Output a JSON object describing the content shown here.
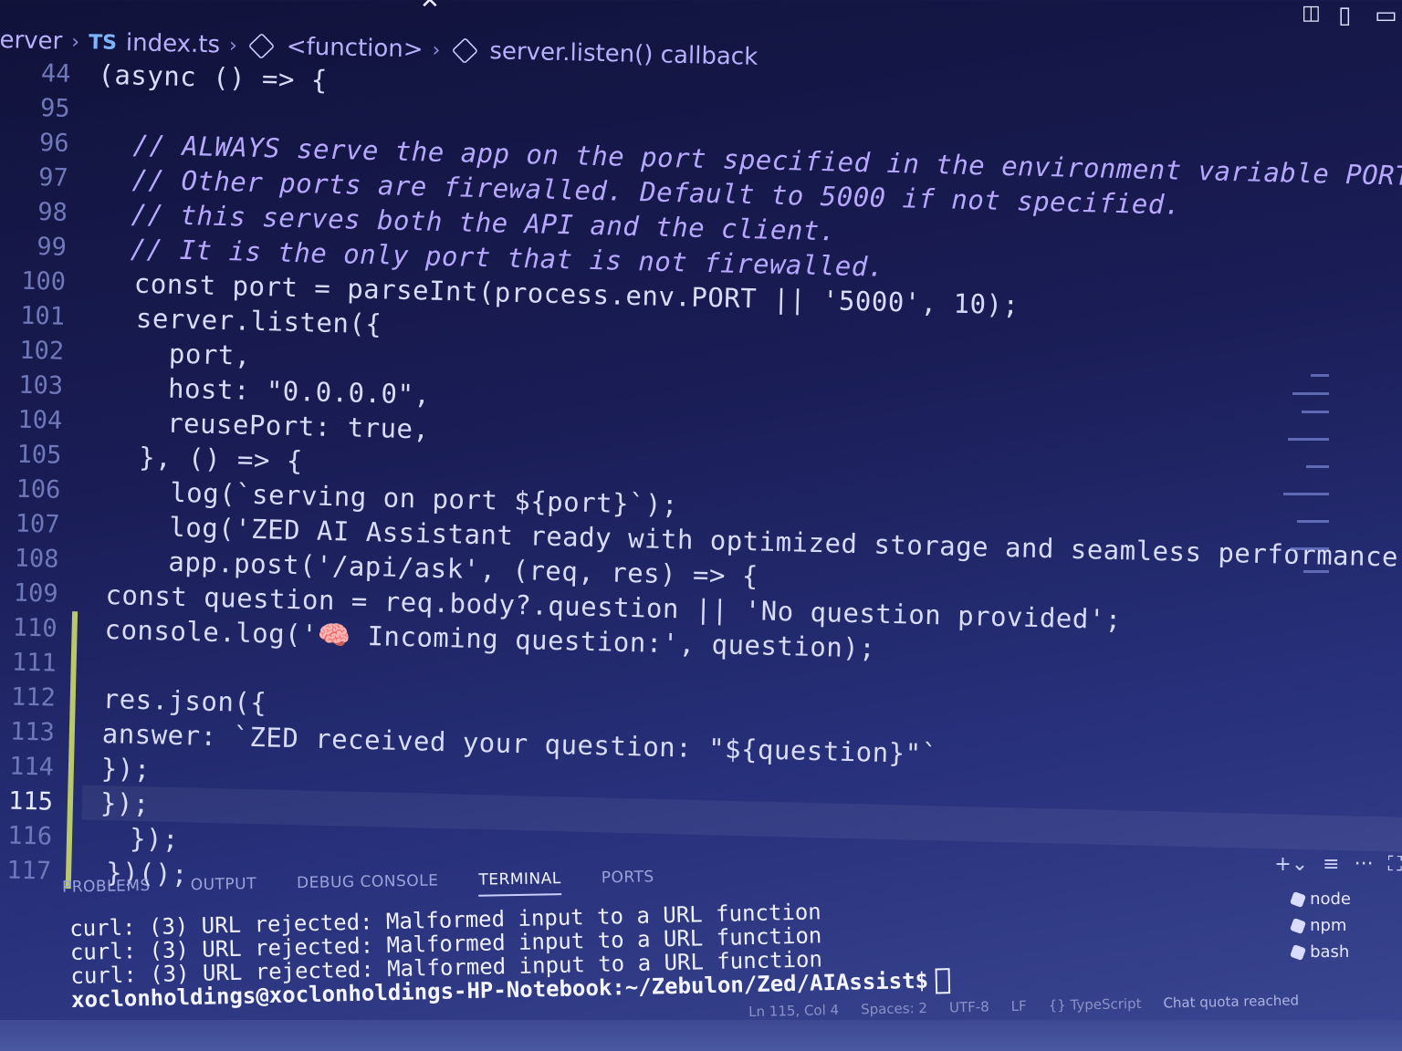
{
  "breadcrumb": {
    "seg1": "erver",
    "ts_badge": "TS",
    "file": "index.ts",
    "seg3": "<function>",
    "seg4": "server.listen() callback"
  },
  "editor": {
    "lines": [
      {
        "n": "44",
        "code": "(async () => {"
      },
      {
        "n": "95",
        "code": ""
      },
      {
        "n": "96",
        "code": "  // ALWAYS serve the app on the port specified in the environment variable PORT"
      },
      {
        "n": "97",
        "code": "  // Other ports are firewalled. Default to 5000 if not specified."
      },
      {
        "n": "98",
        "code": "  // this serves both the API and the client."
      },
      {
        "n": "99",
        "code": "  // It is the only port that is not firewalled."
      },
      {
        "n": "100",
        "code": "  const port = parseInt(process.env.PORT || '5000', 10);"
      },
      {
        "n": "101",
        "code": "  server.listen({"
      },
      {
        "n": "102",
        "code": "    port,"
      },
      {
        "n": "103",
        "code": "    host: \"0.0.0.0\","
      },
      {
        "n": "104",
        "code": "    reusePort: true,"
      },
      {
        "n": "105",
        "code": "  }, () => {"
      },
      {
        "n": "106",
        "code": "    log(`serving on port ${port}`);"
      },
      {
        "n": "107",
        "code": "    log('ZED AI Assistant ready with optimized storage and seamless performance');"
      },
      {
        "n": "108",
        "code": "    app.post('/api/ask', (req, res) => {"
      },
      {
        "n": "109",
        "code": "const question = req.body?.question || 'No question provided';"
      },
      {
        "n": "110",
        "code": "console.log('🧠 Incoming question:', question);"
      },
      {
        "n": "111",
        "code": ""
      },
      {
        "n": "112",
        "code": "res.json({"
      },
      {
        "n": "113",
        "code": "answer: `ZED received your question: \"${question}\"`"
      },
      {
        "n": "114",
        "code": "});"
      },
      {
        "n": "115",
        "code": "});"
      },
      {
        "n": "116",
        "code": "  });"
      },
      {
        "n": "117",
        "code": "})();"
      }
    ],
    "current_line": "115"
  },
  "panel": {
    "tabs": [
      "PROBLEMS",
      "OUTPUT",
      "DEBUG CONSOLE",
      "TERMINAL",
      "PORTS"
    ],
    "active_tab": "TERMINAL",
    "terminal_lines": [
      "curl: (3) URL rejected: Malformed input to a URL function",
      "curl: (3) URL rejected: Malformed input to a URL function",
      "curl: (3) URL rejected: Malformed input to a URL function"
    ],
    "prompt": "xoclonholdings@xoclonholdings-HP-Notebook:~/Zebulon/Zed/AIAssist$",
    "terminals": [
      "node",
      "npm",
      "bash"
    ]
  },
  "status": {
    "position": "Ln 115, Col 4",
    "spaces": "Spaces: 2",
    "encoding": "UTF-8",
    "eol": "LF",
    "language": "{} TypeScript",
    "chat": "Chat quota reached"
  },
  "colors": {
    "background": "#1a1d56",
    "comment": "#b7a8ff",
    "keyword": "#d6c6ff",
    "string": "#f1f1ff",
    "number": "#f4c96a"
  }
}
